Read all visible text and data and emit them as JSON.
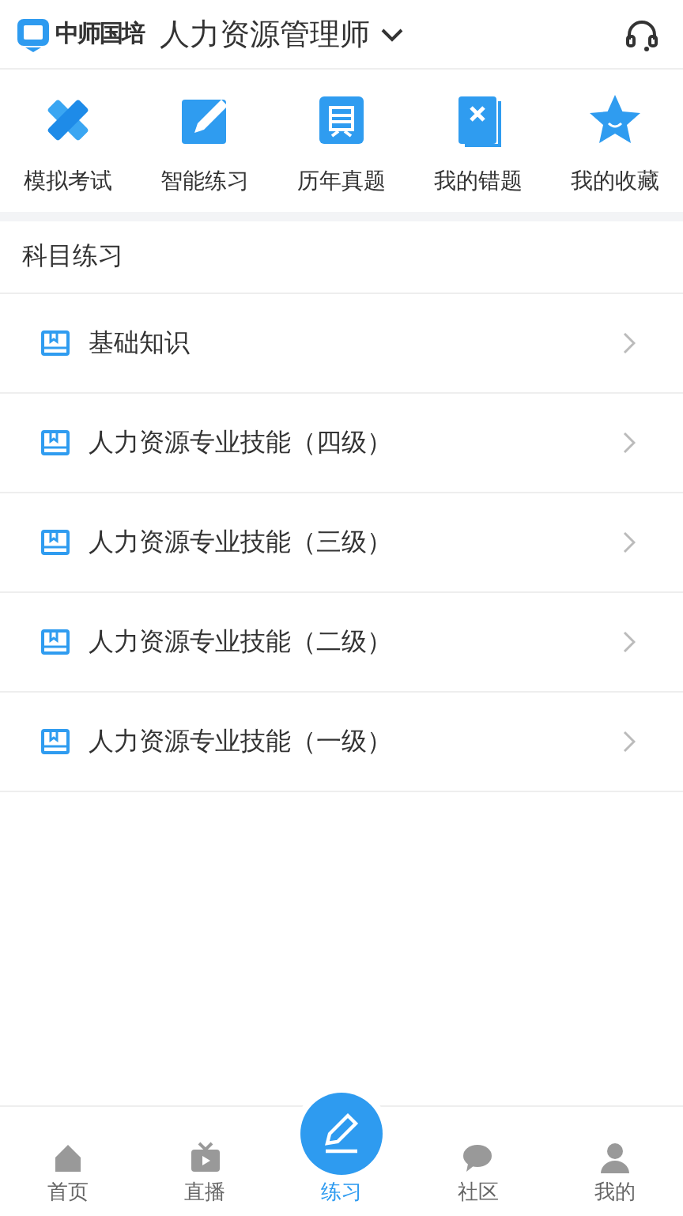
{
  "header": {
    "brand": "中师国培",
    "title": "人力资源管理师"
  },
  "shortcuts": [
    "模拟考试",
    "智能练习",
    "历年真题",
    "我的错题",
    "我的收藏"
  ],
  "section": {
    "title": "科目练习",
    "items": [
      "基础知识",
      "人力资源专业技能（四级）",
      "人力资源专业技能（三级）",
      "人力资源专业技能（二级）",
      "人力资源专业技能（一级）"
    ]
  },
  "tabbar": [
    {
      "label": "首页",
      "selected": false
    },
    {
      "label": "直播",
      "selected": false
    },
    {
      "label": "练习",
      "selected": true
    },
    {
      "label": "社区",
      "selected": false
    },
    {
      "label": "我的",
      "selected": false
    }
  ]
}
